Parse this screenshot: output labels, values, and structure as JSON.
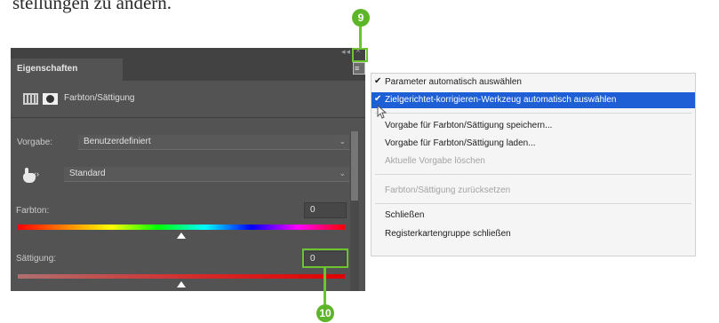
{
  "doc_text": "stellungen zu ändern.",
  "panel": {
    "tab_label": "Eigenschaften",
    "title": "Farbton/Sättigung",
    "preset_label": "Vorgabe:",
    "preset_value": "Benutzerdefiniert",
    "range_value": "Standard",
    "hue_label": "Farbton:",
    "hue_value": "0",
    "hue_level": 0.5,
    "saturation_label": "Sättigung:",
    "saturation_value": "0",
    "saturation_level": 0.5,
    "icons": [
      "hue-saturation-adjustment-icon",
      "layer-mask-icon",
      "targeted-adjustment-hand-icon",
      "panel-menu-icon",
      "close-icon"
    ]
  },
  "menu": {
    "items": [
      {
        "label": "Parameter automatisch auswählen",
        "checked": true
      },
      {
        "label": "Zielgerichtet-korrigieren-Werkzeug automatisch auswählen",
        "checked": true,
        "highlighted": true
      },
      {
        "label": "Vorgabe für Farbton/Sättigung speichern..."
      },
      {
        "label": "Vorgabe für Farbton/Sättigung laden..."
      },
      {
        "label": "Aktuelle Vorgabe löschen",
        "disabled": true
      },
      {
        "label": "Farbton/Sättigung zurücksetzen",
        "disabled": true
      },
      {
        "label": "Schließen"
      },
      {
        "label": "Registerkartengruppe schließen"
      }
    ]
  },
  "callouts": {
    "top": "9",
    "bottom": "10"
  },
  "colors": {
    "callout": "#5db52a",
    "menu_highlight": "#1e5fd6",
    "panel_bg": "#535353"
  }
}
